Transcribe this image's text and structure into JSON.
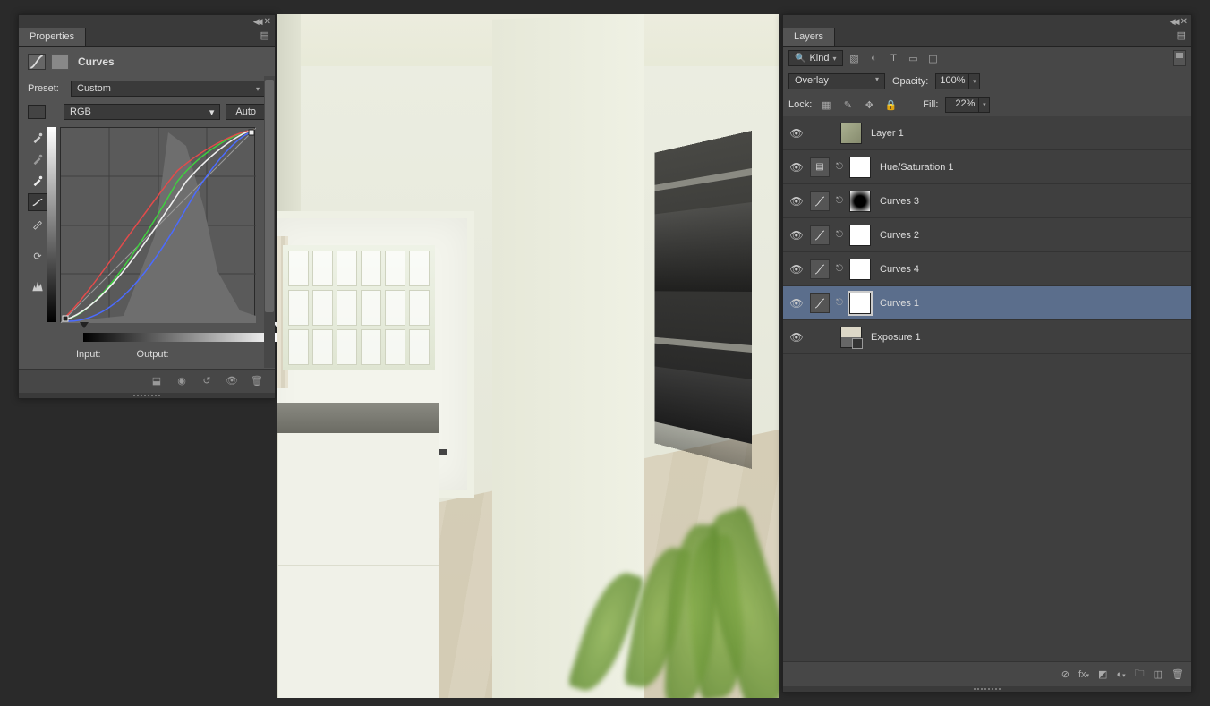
{
  "properties": {
    "tab": "Properties",
    "title": "Curves",
    "preset_label": "Preset:",
    "preset_value": "Custom",
    "channel_value": "RGB",
    "auto_label": "Auto",
    "input_label": "Input:",
    "output_label": "Output:"
  },
  "layers_panel": {
    "tab": "Layers",
    "kind_label": "Kind",
    "blend_mode": "Overlay",
    "opacity_label": "Opacity:",
    "opacity_value": "100%",
    "lock_label": "Lock:",
    "fill_label": "Fill:",
    "fill_value": "22%",
    "layers": [
      {
        "name": "Layer 1",
        "type": "pixel",
        "mask": "none"
      },
      {
        "name": "Hue/Saturation 1",
        "type": "huesat",
        "mask": "white"
      },
      {
        "name": "Curves 3",
        "type": "curves",
        "mask": "dark"
      },
      {
        "name": "Curves 2",
        "type": "curves",
        "mask": "white"
      },
      {
        "name": "Curves 4",
        "type": "curves",
        "mask": "white"
      },
      {
        "name": "Curves 1",
        "type": "curves",
        "mask": "white",
        "selected": true
      },
      {
        "name": "Exposure 1",
        "type": "exposure",
        "mask": "none"
      }
    ]
  }
}
